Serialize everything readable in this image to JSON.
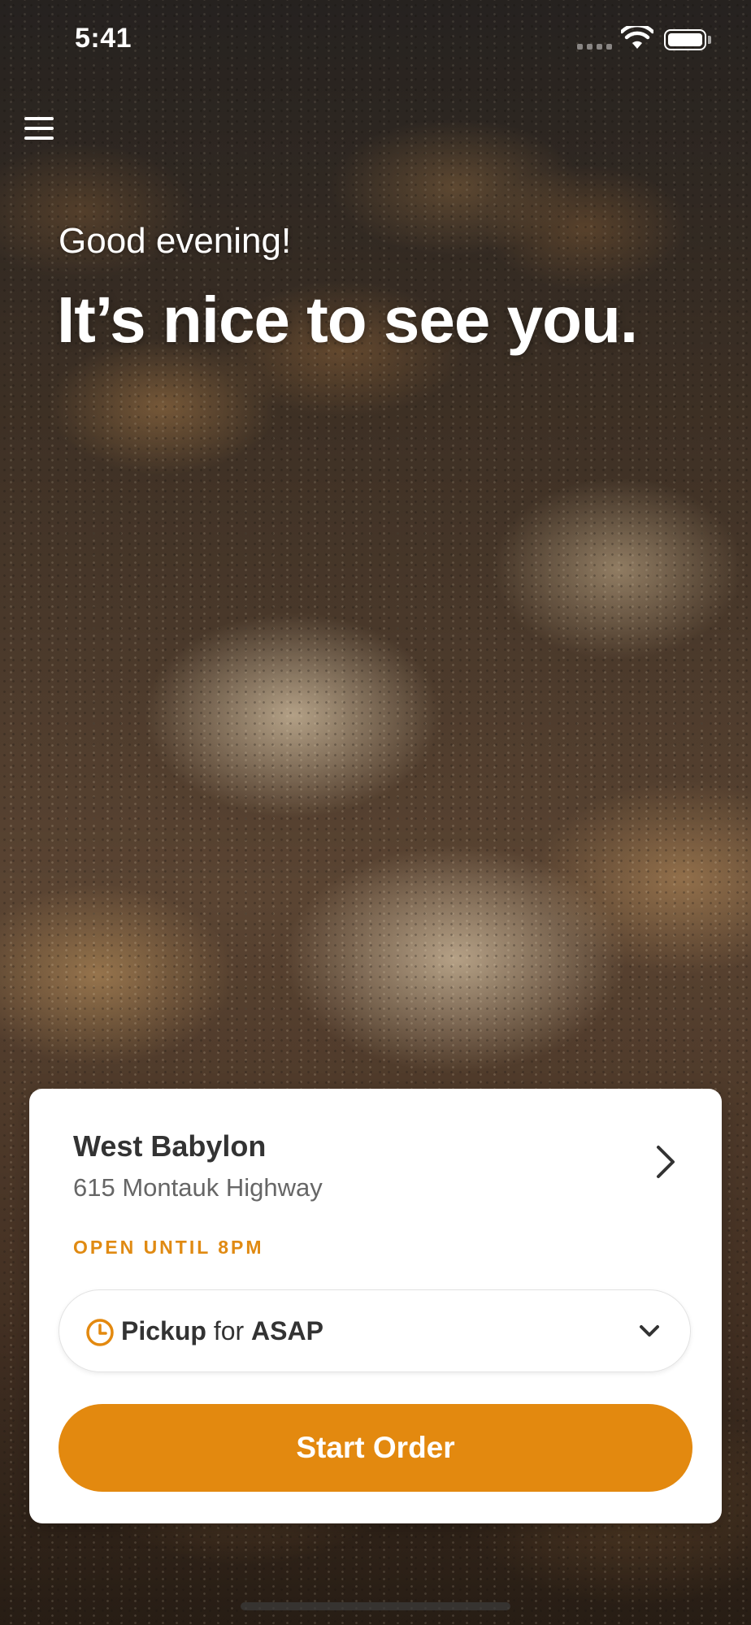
{
  "status_bar": {
    "time": "5:41",
    "icons": [
      "signal-icon",
      "wifi-icon",
      "battery-icon"
    ]
  },
  "header": {
    "menu_icon": "hamburger-menu-icon"
  },
  "hero": {
    "greeting": "Good evening!",
    "headline": "It’s nice to see you."
  },
  "location": {
    "name": "West Babylon",
    "address": "615 Montauk Highway",
    "hours": "OPEN UNTIL 8PM",
    "chevron_icon": "chevron-right-icon"
  },
  "order_mode": {
    "icon": "clock-icon",
    "mode": "Pickup",
    "connector": "for",
    "time": "ASAP",
    "dropdown_icon": "chevron-down-icon"
  },
  "cta": {
    "label": "Start Order"
  },
  "colors": {
    "accent": "#E3890F",
    "card_bg": "#FFFFFF",
    "text_primary": "#333333",
    "text_secondary": "#666666"
  }
}
